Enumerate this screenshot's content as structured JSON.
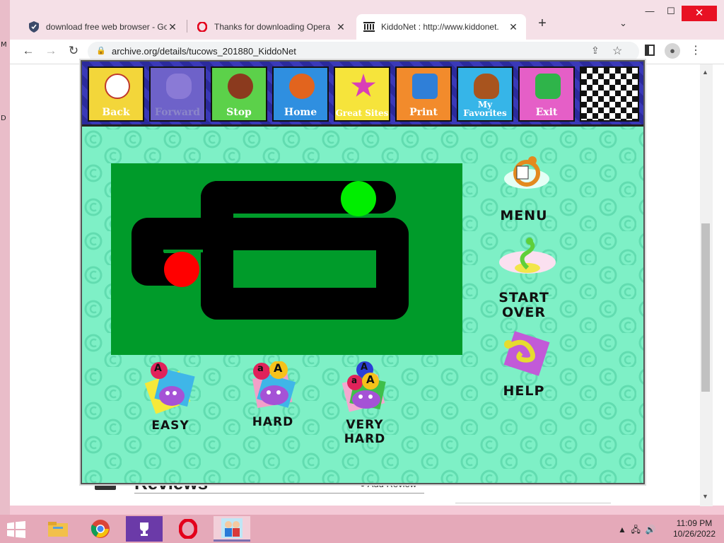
{
  "browser": {
    "tabs": [
      {
        "title": "download free web browser - Go",
        "favicon": "shield-icon",
        "active": false
      },
      {
        "title": "Thanks for downloading Opera",
        "favicon": "opera-icon",
        "active": false
      },
      {
        "title": "KiddoNet : http://www.kiddonet.",
        "favicon": "archive-icon",
        "active": true
      }
    ],
    "new_tab": "+",
    "tab_list": "⌄",
    "window_buttons": {
      "minimize": "—",
      "maximize": "☐",
      "close": "✕"
    },
    "nav": {
      "back": "←",
      "forward": "→",
      "reload": "↻"
    },
    "address": "archive.org/details/tucows_201880_KiddoNet"
  },
  "background_page": {
    "heading": "Reviews",
    "add_review": "Add Review"
  },
  "game": {
    "toolbar": [
      {
        "id": "back",
        "label": "Back",
        "color": "#f3d63a",
        "enabled": true
      },
      {
        "id": "forward",
        "label": "Forward",
        "color": "#6e62c9",
        "enabled": false
      },
      {
        "id": "stop",
        "label": "Stop",
        "color": "#5cd14a",
        "enabled": true
      },
      {
        "id": "home",
        "label": "Home",
        "color": "#2f8fe0",
        "enabled": true
      },
      {
        "id": "great-sites",
        "label": "Great Sites",
        "color": "#f6e43b",
        "enabled": true
      },
      {
        "id": "print",
        "label": "Print",
        "color": "#f28b2c",
        "enabled": true
      },
      {
        "id": "my-favorites",
        "label": "My Favorites",
        "color": "#36b5e8",
        "enabled": true
      },
      {
        "id": "exit",
        "label": "Exit",
        "color": "#e55fc7",
        "enabled": true
      },
      {
        "id": "scene",
        "label": "",
        "color": "#35a5d8",
        "enabled": true
      }
    ],
    "side_menu": {
      "menu": "MENU",
      "start_over": "START OVER",
      "help": "HELP"
    },
    "levels": {
      "easy": "EASY",
      "hard": "HARD",
      "very_hard": "VERY HARD"
    },
    "balloon_letters": {
      "upper": "A",
      "lower": "a"
    },
    "colors": {
      "bg": "#7ef0c6",
      "playfield": "#009b2a",
      "track": "#000000",
      "head": "#ff0000",
      "goal": "#00ee00"
    }
  },
  "taskbar": {
    "apps": [
      "file-explorer",
      "chrome",
      "trophy-app",
      "opera",
      "kiddonet"
    ],
    "time": "11:09 PM",
    "date": "10/26/2022"
  }
}
